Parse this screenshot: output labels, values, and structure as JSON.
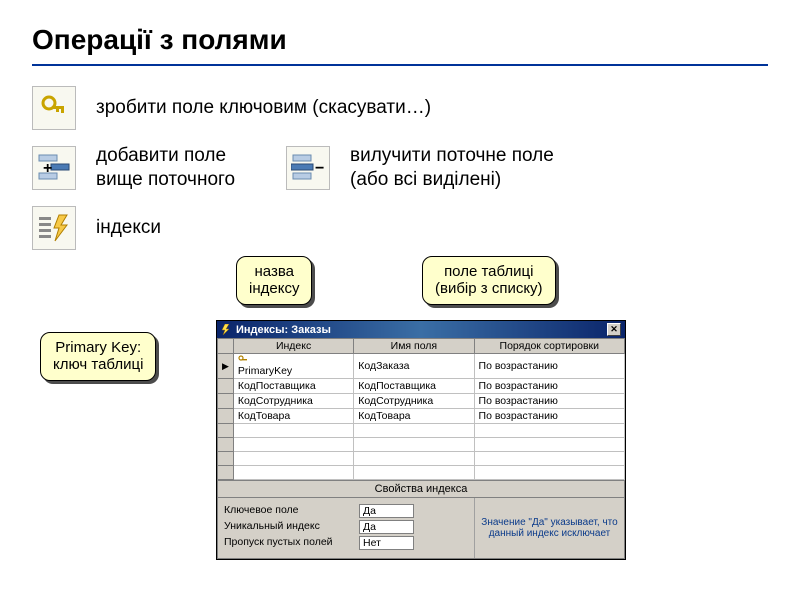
{
  "title": "Операції з полями",
  "items": {
    "key": "зробити поле ключовим (скасувати…)",
    "insert": "добавити поле\nвище поточного",
    "delete": "вилучити поточне поле\n(або всі виділені)",
    "indexes": "індекси"
  },
  "callouts": {
    "index_name": "назва\nіндексу",
    "table_field": "поле таблиці\n(вибір з списку)",
    "primary_key": "Primary Key:\nключ таблиці"
  },
  "dialog": {
    "title": "Индексы: Заказы",
    "columns": [
      "Индекс",
      "Имя поля",
      "Порядок сортировки"
    ],
    "rows": [
      {
        "marker": "▶",
        "key": true,
        "index": "PrimaryKey",
        "field": "КодЗаказа",
        "order": "По возрастанию"
      },
      {
        "marker": "",
        "key": false,
        "index": "КодПоставщика",
        "field": "КодПоставщика",
        "order": "По возрастанию"
      },
      {
        "marker": "",
        "key": false,
        "index": "КодСотрудника",
        "field": "КодСотрудника",
        "order": "По возрастанию"
      },
      {
        "marker": "",
        "key": false,
        "index": "КодТовара",
        "field": "КодТовара",
        "order": "По возрастанию"
      }
    ],
    "props_title": "Свойства индекса",
    "props": [
      {
        "label": "Ключевое поле",
        "value": "Да"
      },
      {
        "label": "Уникальный индекс",
        "value": "Да"
      },
      {
        "label": "Пропуск пустых полей",
        "value": "Нет"
      }
    ],
    "hint": "Значение \"Да\" указывает, что данный индекс исключает"
  },
  "icons": {
    "key": "key-icon",
    "insert": "insert-row-icon",
    "delete": "delete-row-icon",
    "indexes": "lightning-list-icon",
    "bolt": "bolt-icon",
    "close": "close-icon"
  }
}
